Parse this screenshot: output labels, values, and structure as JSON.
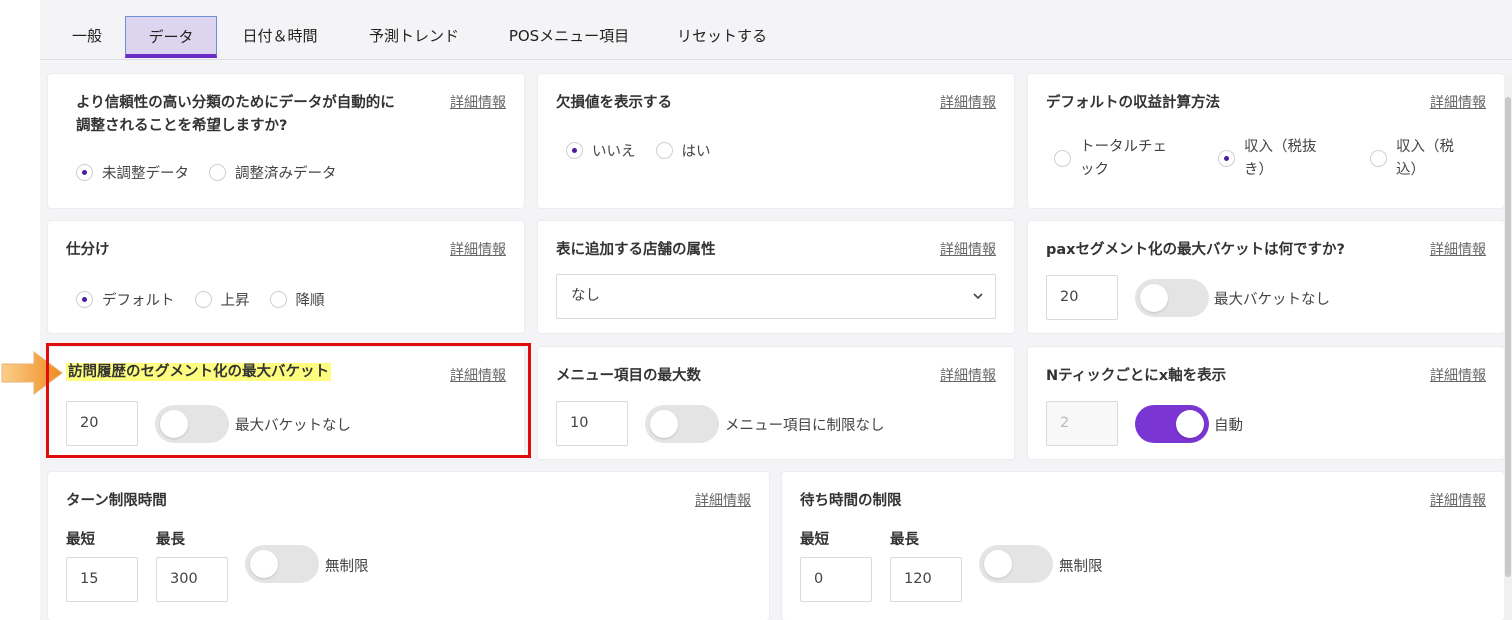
{
  "tabs": [
    {
      "label": "一般"
    },
    {
      "label": "データ"
    },
    {
      "label": "日付＆時間"
    },
    {
      "label": "予測トレンド"
    },
    {
      "label": "POSメニュー項目"
    },
    {
      "label": "リセットする"
    }
  ],
  "active_tab": "データ",
  "detail_label": "詳細情報",
  "cards": {
    "adjust": {
      "title_line1": "より信頼性の高い分類のためにデータが自動的に",
      "title_line2": "調整されることを希望しますか?",
      "options": [
        "未調整データ",
        "調整済みデータ"
      ],
      "selected": "未調整データ"
    },
    "missing": {
      "title": "欠損値を表示する",
      "options": [
        "いいえ",
        "はい"
      ],
      "selected": "いいえ"
    },
    "revenue": {
      "title": "デフォルトの収益計算方法",
      "options": [
        {
          "line1": "トータルチェ",
          "line2": "ック"
        },
        {
          "line1": "収入（税抜",
          "line2": "き）"
        },
        {
          "line1": "収入（税",
          "line2": "込）"
        }
      ],
      "selected": "収入（税抜き）"
    },
    "sort": {
      "title": "仕分け",
      "options": [
        "デフォルト",
        "上昇",
        "降順"
      ],
      "selected": "デフォルト"
    },
    "store_attr": {
      "title": "表に追加する店舗の属性",
      "value": "なし"
    },
    "pax": {
      "title": "paxセグメント化の最大バケットは何ですか?",
      "value": "20",
      "toggle_label": "最大バケットなし",
      "toggle_on": false
    },
    "visit": {
      "title": "訪問履歴のセグメント化の最大バケット",
      "value": "20",
      "toggle_label": "最大バケットなし",
      "toggle_on": false
    },
    "menu_max": {
      "title": "メニュー項目の最大数",
      "value": "10",
      "toggle_label": "メニュー項目に制限なし",
      "toggle_on": false
    },
    "xaxis": {
      "title": "Nティックごとにx軸を表示",
      "value": "2",
      "toggle_label": "自動",
      "toggle_on": true
    },
    "turn": {
      "title": "ターン制限時間",
      "min_label": "最短",
      "max_label": "最長",
      "min_value": "15",
      "max_value": "300",
      "toggle_label": "無制限",
      "toggle_on": false
    },
    "wait": {
      "title": "待ち時間の制限",
      "min_label": "最短",
      "max_label": "最長",
      "min_value": "0",
      "max_value": "120",
      "toggle_label": "無制限",
      "toggle_on": false
    }
  },
  "colors": {
    "accent": "#7a35d2",
    "highlight_box": "#e10b0b",
    "highlight_text": "#fdfd80",
    "arrow": "#f5a03c"
  }
}
